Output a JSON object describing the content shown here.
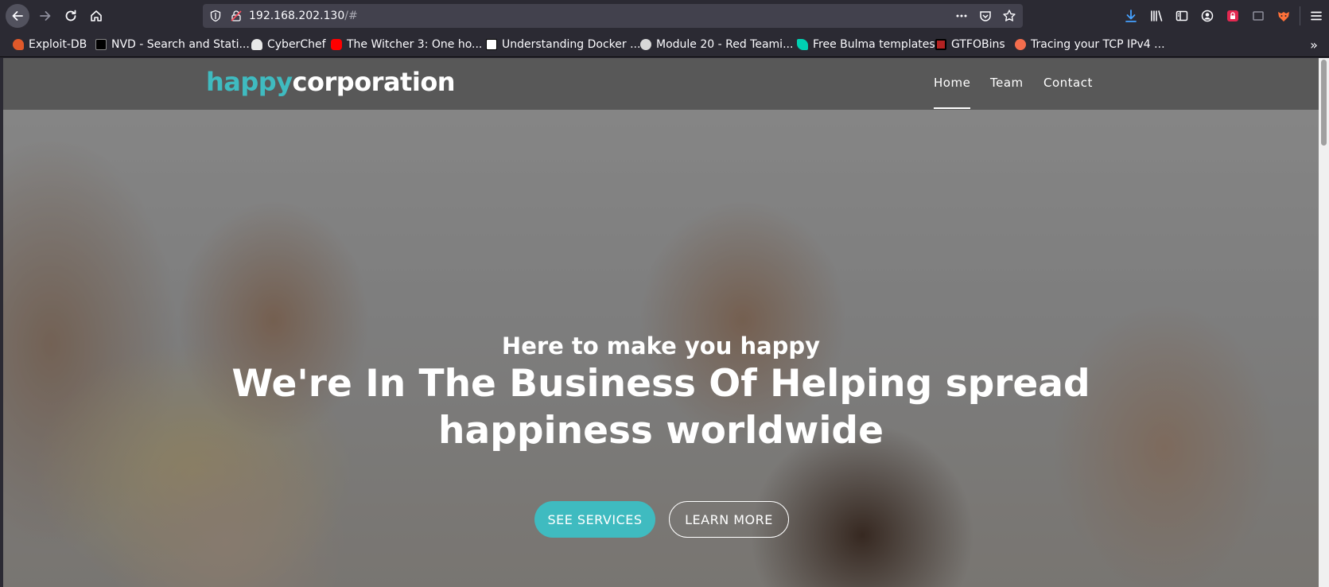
{
  "browser": {
    "url_host": "192.168.202.130",
    "url_hash": "/#",
    "bookmarks": [
      {
        "label": "Exploit-DB",
        "color": "#e0592a"
      },
      {
        "label": "NVD - Search and Stati...",
        "color": "#000000"
      },
      {
        "label": "CyberChef",
        "color": "#e8e8e8"
      },
      {
        "label": "The Witcher 3: One ho...",
        "color": "#ff0000"
      },
      {
        "label": "Understanding Docker ...",
        "color": "#ffffff"
      },
      {
        "label": "Module 20 - Red Teami...",
        "color": "#d8d8d8"
      },
      {
        "label": "Free Bulma templates",
        "color": "#00d1b2"
      },
      {
        "label": "GTFOBins",
        "color": "#b22222"
      },
      {
        "label": "Tracing your TCP IPv4 ...",
        "color": "#f36d4d"
      }
    ]
  },
  "site": {
    "logo_part1": "happy",
    "logo_part2": "corporation",
    "nav": {
      "home": "Home",
      "team": "Team",
      "contact": "Contact"
    },
    "hero": {
      "subtitle": "Here to make you happy",
      "title_line1": "We're In The Business Of Helping spread",
      "title_line2": "happiness worldwide",
      "btn_services": "SEE SERVICES",
      "btn_learn": "LEARN MORE"
    },
    "colors": {
      "accent": "#3fbbc0"
    }
  }
}
